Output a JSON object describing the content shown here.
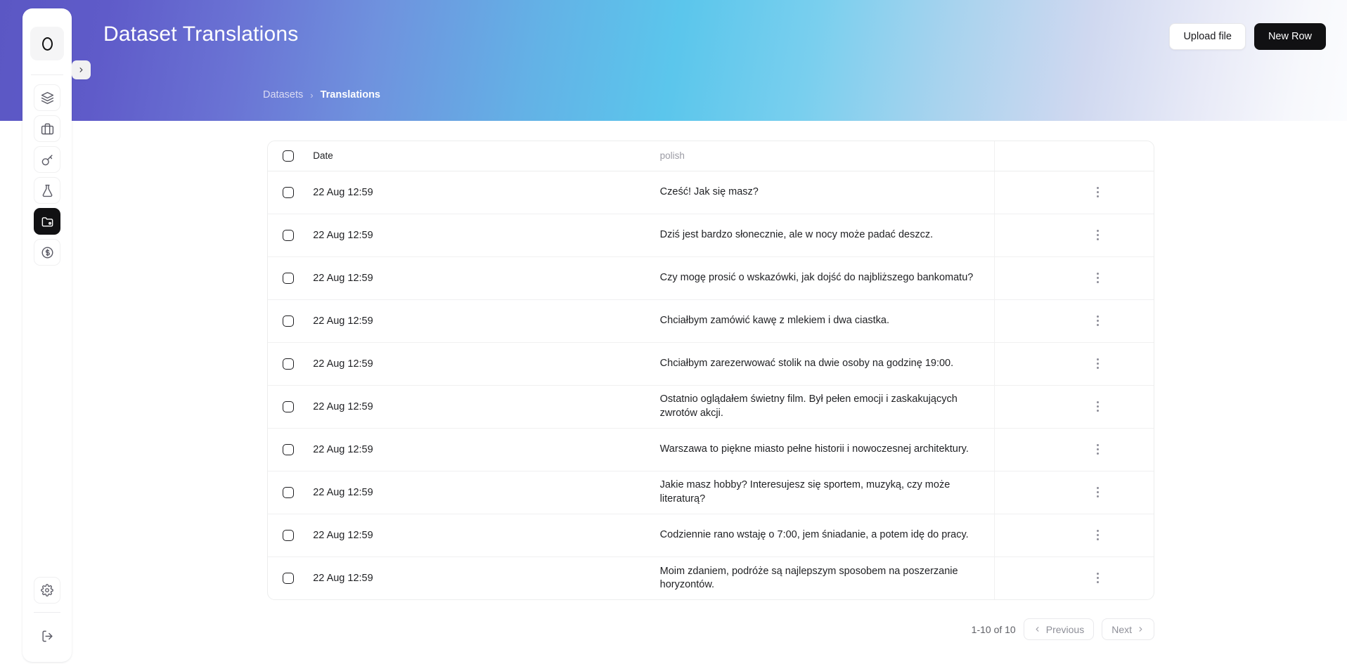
{
  "header": {
    "title": "Dataset Translations",
    "upload_label": "Upload file",
    "new_row_label": "New Row"
  },
  "breadcrumb": {
    "parent": "Datasets",
    "separator": "›",
    "current": "Translations"
  },
  "sidebar": {
    "logo_name": "app-logo-o",
    "nav": [
      {
        "icon": "layers-icon",
        "name": "sidebar-item-layers"
      },
      {
        "icon": "briefcase-icon",
        "name": "sidebar-item-projects"
      },
      {
        "icon": "key-icon",
        "name": "sidebar-item-api-keys"
      },
      {
        "icon": "flask-icon",
        "name": "sidebar-item-experiments"
      },
      {
        "icon": "folder-icon",
        "name": "sidebar-item-datasets",
        "active": true
      },
      {
        "icon": "dollar-icon",
        "name": "sidebar-item-billing"
      }
    ],
    "bottom": [
      {
        "icon": "gear-icon",
        "name": "sidebar-item-settings"
      },
      {
        "icon": "logout-icon",
        "name": "sidebar-item-logout"
      }
    ],
    "expand_icon": "chevron-right-icon"
  },
  "table": {
    "columns": [
      "",
      "Date",
      "polish",
      ""
    ],
    "rows": [
      {
        "date": "22 Aug 12:59",
        "polish": "Cześć! Jak się masz?"
      },
      {
        "date": "22 Aug 12:59",
        "polish": "Dziś jest bardzo słonecznie, ale w nocy może padać deszcz."
      },
      {
        "date": "22 Aug 12:59",
        "polish": "Czy mogę prosić o wskazówki, jak dojść do najbliższego bankomatu?"
      },
      {
        "date": "22 Aug 12:59",
        "polish": "Chciałbym zamówić kawę z mlekiem i dwa ciastka."
      },
      {
        "date": "22 Aug 12:59",
        "polish": "Chciałbym zarezerwować stolik na dwie osoby na godzinę 19:00."
      },
      {
        "date": "22 Aug 12:59",
        "polish": "Ostatnio oglądałem świetny film. Był pełen emocji i zaskakujących zwrotów akcji."
      },
      {
        "date": "22 Aug 12:59",
        "polish": "Warszawa to piękne miasto pełne historii i nowoczesnej architektury."
      },
      {
        "date": "22 Aug 12:59",
        "polish": "Jakie masz hobby? Interesujesz się sportem, muzyką, czy może literaturą?"
      },
      {
        "date": "22 Aug 12:59",
        "polish": "Codziennie rano wstaję o 7:00, jem śniadanie, a potem idę do pracy."
      },
      {
        "date": "22 Aug 12:59",
        "polish": "Moim zdaniem, podróże są najlepszym sposobem na poszerzanie horyzontów."
      }
    ]
  },
  "pagination": {
    "count_label": "1-10 of 10",
    "previous_label": "Previous",
    "next_label": "Next",
    "prev_icon": "chevron-left-icon",
    "next_icon": "chevron-right-icon"
  },
  "colors": {
    "gradient_start": "#5b57c4",
    "gradient_mid": "#5bc6ec",
    "gradient_end": "#fbfcfe",
    "accent_dark": "#111113"
  }
}
